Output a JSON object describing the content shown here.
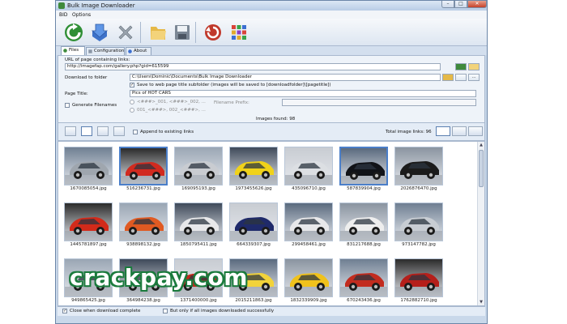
{
  "window": {
    "title": "Bulk Image Downloader",
    "controls": [
      "–",
      "□",
      "✕"
    ]
  },
  "menu": [
    "BID",
    "Options"
  ],
  "toolbar": {
    "icons": [
      "refresh-icon",
      "download-icon",
      "stop-icon",
      "folder-icon",
      "save-icon",
      "reload-icon",
      "grid-icon"
    ]
  },
  "tabs": [
    "Files",
    "Configuration",
    "About"
  ],
  "form": {
    "url_label": "URL of page containing links:",
    "url_value": "http://imagefap.com/gallery.php?gid=615599",
    "folder_label": "Download to folder",
    "folder_value": "C:\\Users\\Dominic\\Documents\\Bulk Image Downloader",
    "subfolder_checkbox": "Save to web page title subfolder (images will be saved to [downloadfolder]\\[pagetitle])",
    "page_title_label": "Page Title:",
    "page_title_value": "Pics of HOT CARS",
    "generate_label": "Generate Filenames",
    "radio1": "<###>_001, <###>_002, ...",
    "radio2": "001_<###>, 002_<###>, ...",
    "filename_prefix_label": "Filename Prefix:",
    "browse_button": "...",
    "images_found": "Images found: 98"
  },
  "viewbar": {
    "append_label": "Append to existing links",
    "total_links": "Total image links: 96"
  },
  "gallery": {
    "rows": [
      [
        "1670085054.jpg",
        "516236731.jpg",
        "169095193.jpg",
        "1973455626.jpg",
        "435096710.jpg",
        "587839904.jpg",
        "2026876470.jpg"
      ],
      [
        "1445781897.jpg",
        "938898132.jpg",
        "1850795411.jpg",
        "664339307.jpg",
        "299458461.jpg",
        "831217688.jpg",
        "973147782.jpg"
      ],
      [
        "949865425.jpg",
        "364984238.jpg",
        "1371400000.jpg",
        "2015211863.jpg",
        "1832339909.jpg",
        "670243436.jpg",
        "1762882710.jpg"
      ]
    ]
  },
  "status": {
    "close_when_done": "Close when download complete",
    "only_if_all": "But only if all images downloaded successfully"
  },
  "watermark": "crackpay.com",
  "colors": {
    "window_bg": "#c9d8ea",
    "accent_green": "#3f8a3c",
    "watermark_outline": "#1a7a3c"
  }
}
